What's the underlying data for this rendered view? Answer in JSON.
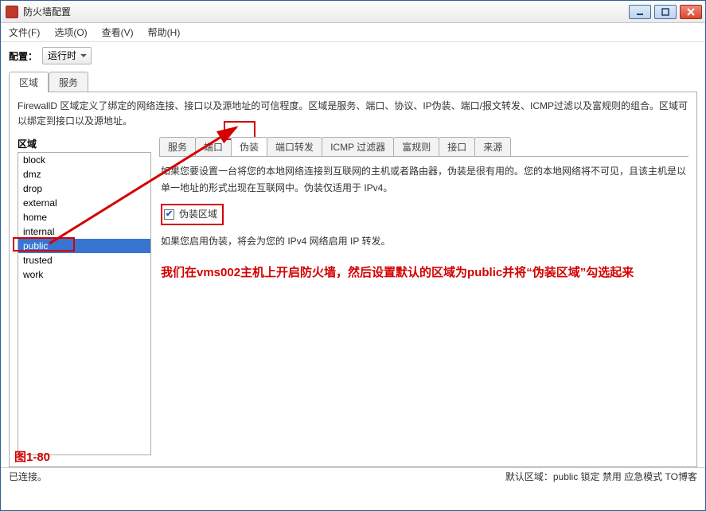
{
  "window": {
    "title": "防火墙配置"
  },
  "menu": {
    "file": "文件(F)",
    "options": "选项(O)",
    "view": "查看(V)",
    "help": "帮助(H)"
  },
  "config": {
    "label": "配置：",
    "value": "运行时"
  },
  "outer_tabs": {
    "zone": "区域",
    "service": "服务"
  },
  "description": "FirewallD 区域定义了绑定的网络连接、接口以及源地址的可信程度。区域是服务、端口、协议、IP伪装、端口/报文转发、ICMP过滤以及富规则的组合。区域可以绑定到接口以及源地址。",
  "zones": {
    "label": "区域",
    "items": [
      "block",
      "dmz",
      "drop",
      "external",
      "home",
      "internal",
      "public",
      "trusted",
      "work"
    ],
    "selected_index": 6
  },
  "inner_tabs": {
    "items": [
      "服务",
      "端口",
      "伪装",
      "端口转发",
      "ICMP 过滤器",
      "富规则",
      "接口",
      "来源"
    ],
    "active_index": 2
  },
  "masq": {
    "desc1": "如果您要设置一台将您的本地网络连接到互联网的主机或者路由器，伪装是很有用的。您的本地网络将不可见，且该主机是以单一地址的形式出现在互联网中。伪装仅适用于 IPv4。",
    "checkbox_label": "伪装区域",
    "checked": true,
    "desc2": "如果您启用伪装，将会为您的 IPv4 网络启用 IP 转发。"
  },
  "annotation": "我们在vms002主机上开启防火墙，然后设置默认的区域为public并将“伪装区域”勾选起来",
  "figure": "图1-80",
  "status": {
    "left": "已连接。",
    "right": "默认区域：public 锁定 禁用 应急模式 TO博客"
  }
}
